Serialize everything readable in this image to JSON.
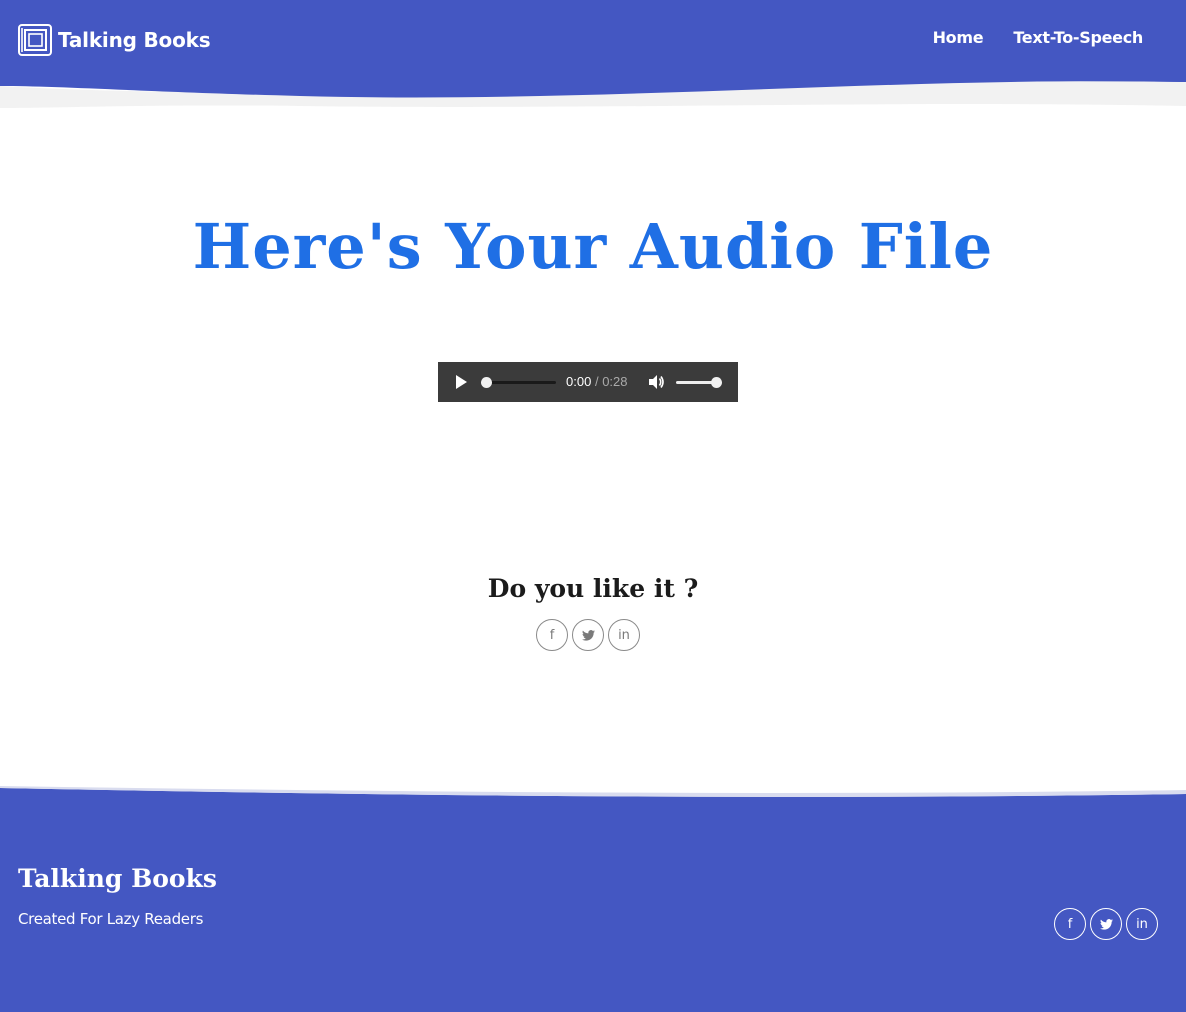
{
  "colors": {
    "nav_bg": "#4457c2",
    "hero_title": "#1f6fe5",
    "player_bg": "#3b3b3b",
    "page_bg": "#ffffff"
  },
  "header": {
    "brand": {
      "icon": "book-icon",
      "name": "Talking Books"
    },
    "nav": [
      {
        "label": "Home"
      },
      {
        "label": "Text-To-Speech"
      }
    ]
  },
  "main": {
    "title": "Here's Your Audio File",
    "audio": {
      "current_time": "0:00",
      "separator": "/",
      "duration": "0:28",
      "progress": 0,
      "volume": 1.0,
      "play_icon": "play-icon",
      "volume_icon": "volume-icon"
    },
    "share": {
      "title": "Do you like it ?",
      "icons": [
        {
          "icon": "facebook-icon",
          "glyph": "f"
        },
        {
          "icon": "twitter-icon",
          "glyph": "🐦"
        },
        {
          "icon": "linkedin-icon",
          "glyph": "in"
        }
      ]
    }
  },
  "footer": {
    "title": "Talking Books",
    "tagline": "Created For Lazy Readers",
    "icons": [
      {
        "icon": "facebook-icon",
        "glyph": "f"
      },
      {
        "icon": "twitter-icon",
        "glyph": "🐦"
      },
      {
        "icon": "linkedin-icon",
        "glyph": "in"
      }
    ]
  }
}
